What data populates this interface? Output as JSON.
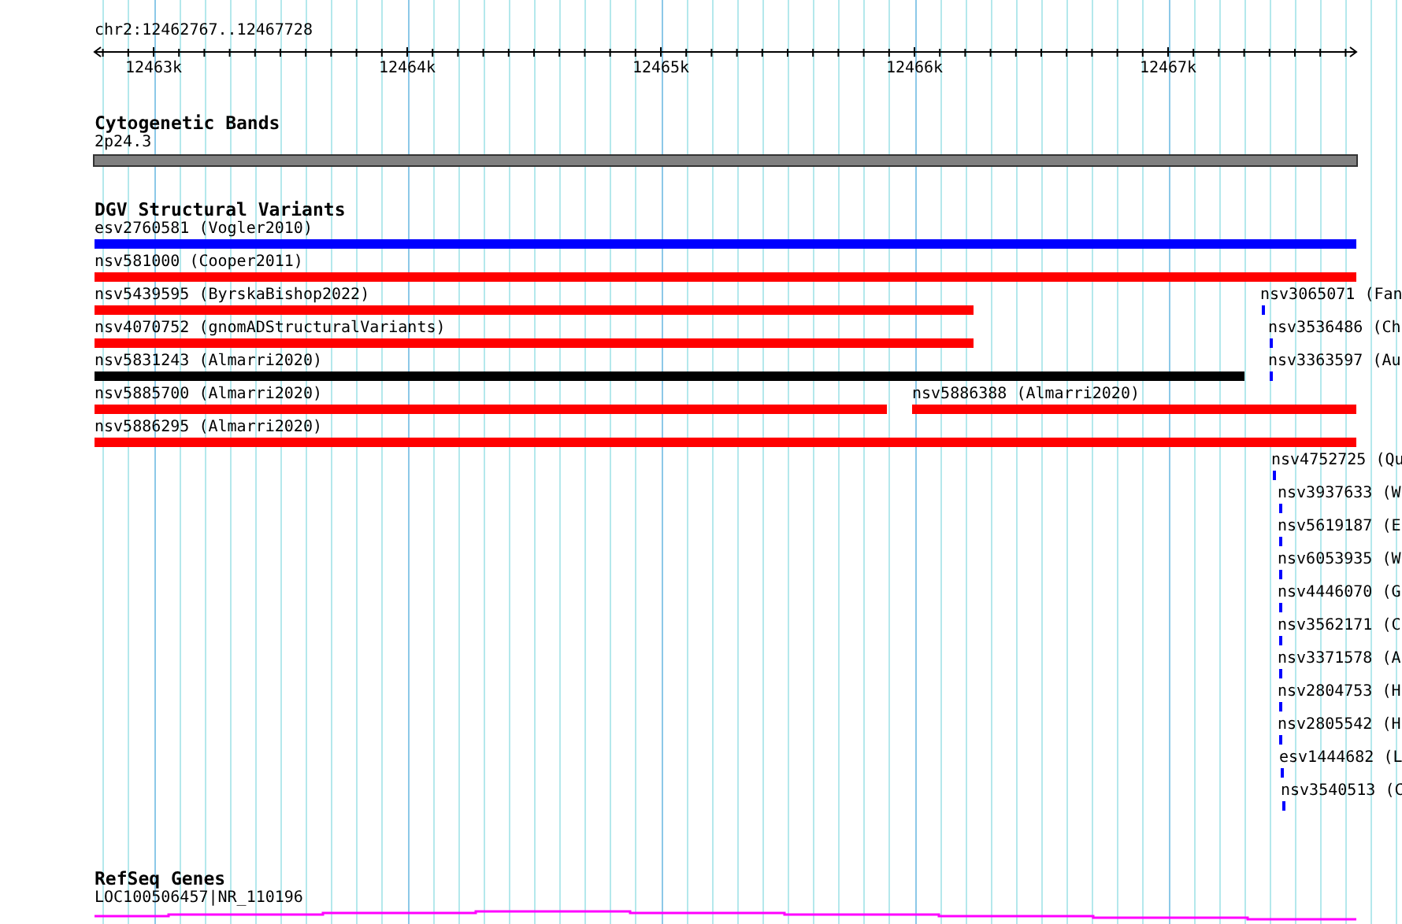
{
  "ruler": {
    "locus": "chr2:12462767..12467728",
    "ticks": [
      "12463k",
      "12464k",
      "12465k",
      "12466k",
      "12467k"
    ]
  },
  "cytogenetic": {
    "title": "Cytogenetic Bands",
    "features": [
      {
        "label": "2p24.3"
      }
    ]
  },
  "dgv": {
    "title": "DGV Structural Variants",
    "features": [
      {
        "label": "esv2760581 (Vogler2010)",
        "color": "#0000ff"
      },
      {
        "label": "nsv581000 (Cooper2011)",
        "color": "#ff0000"
      },
      {
        "label": "nsv5439595 (ByrskaBishop2022)",
        "color": "#ff0000"
      },
      {
        "label": "nsv3065071 (Fan",
        "color": "#0000ff"
      },
      {
        "label": "nsv4070752 (gnomADStructuralVariants)",
        "color": "#ff0000"
      },
      {
        "label": "nsv3536486 (Ch",
        "color": "#0000ff"
      },
      {
        "label": "nsv5831243 (Almarri2020)",
        "color": "#000000"
      },
      {
        "label": "nsv3363597 (Au",
        "color": "#0000ff"
      },
      {
        "label": "nsv5885700 (Almarri2020)",
        "color": "#ff0000"
      },
      {
        "label": "nsv5886388 (Almarri2020)",
        "color": "#ff0000"
      },
      {
        "label": "nsv5886295 (Almarri2020)",
        "color": "#ff0000"
      },
      {
        "label": "nsv4752725 (Qu",
        "color": "#0000ff"
      },
      {
        "label": "nsv3937633 (W",
        "color": "#0000ff"
      },
      {
        "label": "nsv5619187 (E",
        "color": "#0000ff"
      },
      {
        "label": "nsv6053935 (W",
        "color": "#0000ff"
      },
      {
        "label": "nsv4446070 (G",
        "color": "#0000ff"
      },
      {
        "label": "nsv3562171 (C",
        "color": "#0000ff"
      },
      {
        "label": "nsv3371578 (A",
        "color": "#0000ff"
      },
      {
        "label": "nsv2804753 (H",
        "color": "#0000ff"
      },
      {
        "label": "nsv2805542 (H",
        "color": "#0000ff"
      },
      {
        "label": "esv1444682 (L",
        "color": "#0000ff"
      },
      {
        "label": "nsv3540513 (C",
        "color": "#0000ff"
      }
    ]
  },
  "refseq": {
    "title": "RefSeq Genes",
    "features": [
      {
        "label": "LOC100506457|NR_110196"
      }
    ]
  }
}
